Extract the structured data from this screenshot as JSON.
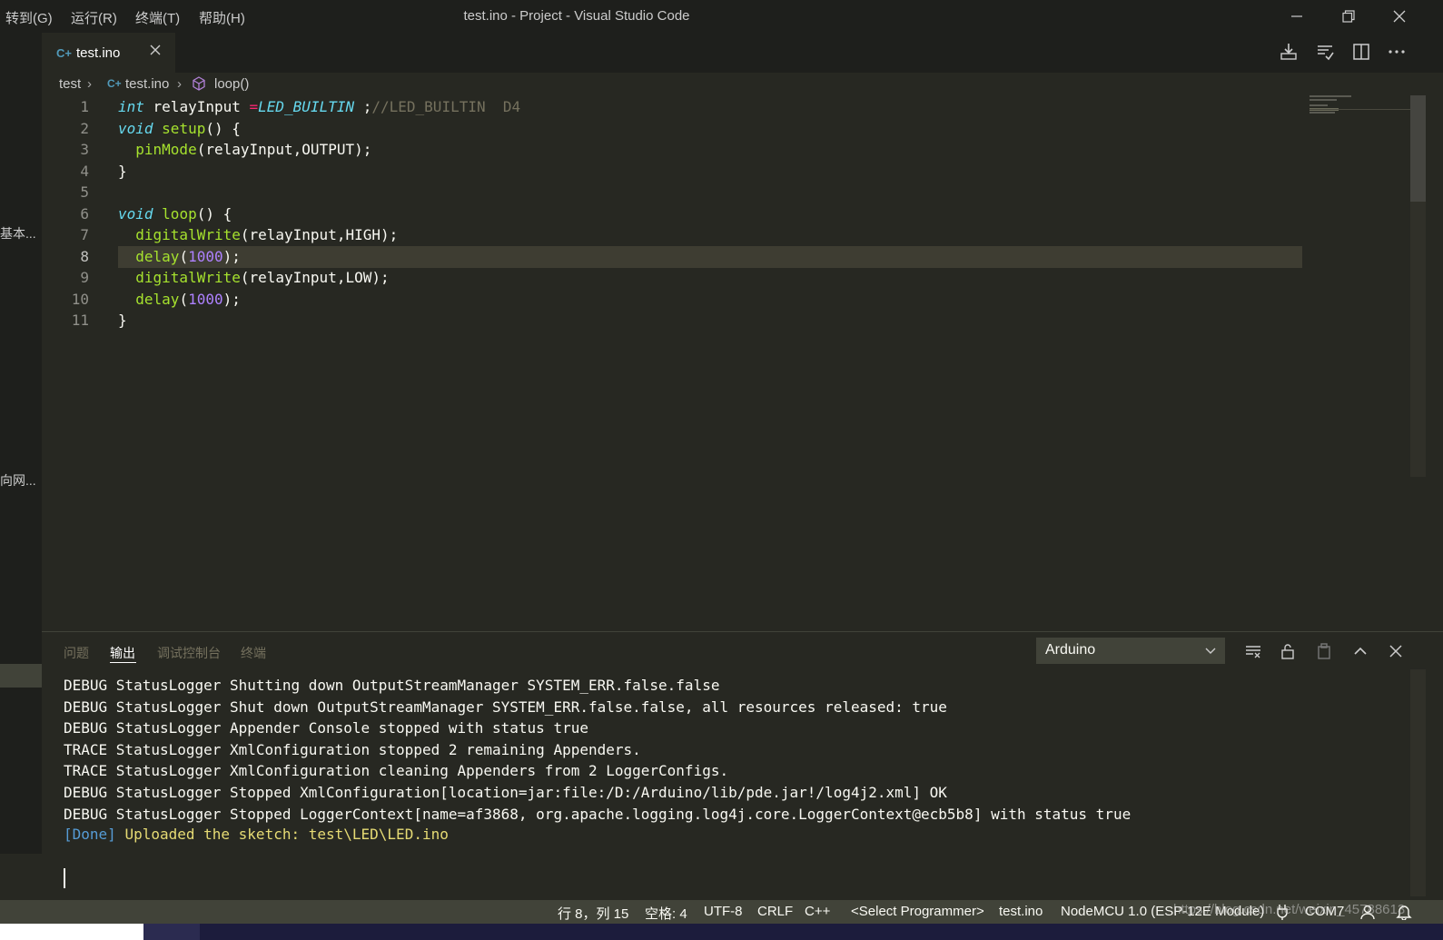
{
  "menu": [
    "转到(G)",
    "运行(R)",
    "终端(T)",
    "帮助(H)"
  ],
  "window_title": "test.ino - Project - Visual Studio Code",
  "tab": {
    "label": "test.ino",
    "icon": "cpp-file-icon"
  },
  "breadcrumb": {
    "folder": "test",
    "file": "test.ino",
    "symbol": "loop()"
  },
  "sidebar_fragments": [
    "基本...",
    "向网..."
  ],
  "editor": {
    "lines": [
      {
        "n": "1",
        "tokens": [
          {
            "c": "kw",
            "t": "int"
          },
          {
            "c": "",
            "t": " relayInput "
          },
          {
            "c": "op",
            "t": "="
          },
          {
            "c": "cst",
            "t": "LED_BUILTIN"
          },
          {
            "c": "",
            "t": " ;"
          },
          {
            "c": "cm",
            "t": "//LED_BUILTIN  D4"
          }
        ]
      },
      {
        "n": "2",
        "tokens": [
          {
            "c": "kw",
            "t": "void"
          },
          {
            "c": "",
            "t": " "
          },
          {
            "c": "fn",
            "t": "setup"
          },
          {
            "c": "",
            "t": "() {"
          }
        ]
      },
      {
        "n": "3",
        "tokens": [
          {
            "c": "",
            "t": "  "
          },
          {
            "c": "fn",
            "t": "pinMode"
          },
          {
            "c": "",
            "t": "(relayInput,OUTPUT);"
          }
        ]
      },
      {
        "n": "4",
        "tokens": [
          {
            "c": "",
            "t": "}"
          }
        ]
      },
      {
        "n": "5",
        "tokens": []
      },
      {
        "n": "6",
        "tokens": [
          {
            "c": "kw",
            "t": "void"
          },
          {
            "c": "",
            "t": " "
          },
          {
            "c": "fn",
            "t": "loop"
          },
          {
            "c": "",
            "t": "() {"
          }
        ]
      },
      {
        "n": "7",
        "tokens": [
          {
            "c": "",
            "t": "  "
          },
          {
            "c": "fn",
            "t": "digitalWrite"
          },
          {
            "c": "",
            "t": "(relayInput,HIGH);"
          }
        ]
      },
      {
        "n": "8",
        "tokens": [
          {
            "c": "",
            "t": "  "
          },
          {
            "c": "fn",
            "t": "delay"
          },
          {
            "c": "",
            "t": "("
          },
          {
            "c": "num",
            "t": "1000"
          },
          {
            "c": "",
            "t": ");"
          }
        ]
      },
      {
        "n": "9",
        "tokens": [
          {
            "c": "",
            "t": "  "
          },
          {
            "c": "fn",
            "t": "digitalWrite"
          },
          {
            "c": "",
            "t": "(relayInput,LOW);"
          }
        ]
      },
      {
        "n": "10",
        "tokens": [
          {
            "c": "",
            "t": "  "
          },
          {
            "c": "fn",
            "t": "delay"
          },
          {
            "c": "",
            "t": "("
          },
          {
            "c": "num",
            "t": "1000"
          },
          {
            "c": "",
            "t": ");"
          }
        ]
      },
      {
        "n": "11",
        "tokens": [
          {
            "c": "",
            "t": "}"
          }
        ]
      }
    ],
    "active_line": 8
  },
  "panel": {
    "tabs": [
      {
        "label": "问题",
        "active": false
      },
      {
        "label": "输出",
        "active": true
      },
      {
        "label": "调试控制台",
        "active": false
      },
      {
        "label": "终端",
        "active": false
      }
    ],
    "output_channel": "Arduino",
    "output_lines": [
      {
        "text": "DEBUG StatusLogger Shutting down OutputStreamManager SYSTEM_ERR.false.false",
        "style": "log"
      },
      {
        "text": "DEBUG StatusLogger Shut down OutputStreamManager SYSTEM_ERR.false.false, all resources released: true",
        "style": "log"
      },
      {
        "text": "DEBUG StatusLogger Appender Console stopped with status true",
        "style": "log"
      },
      {
        "text": "TRACE StatusLogger XmlConfiguration stopped 2 remaining Appenders.",
        "style": "log"
      },
      {
        "text": "TRACE StatusLogger XmlConfiguration cleaning Appenders from 2 LoggerConfigs.",
        "style": "log"
      },
      {
        "text": "DEBUG StatusLogger Stopped XmlConfiguration[location=jar:file:/D:/Arduino/lib/pde.jar!/log4j2.xml] OK",
        "style": "log"
      },
      {
        "text": "DEBUG StatusLogger Stopped LoggerContext[name=af3868, org.apache.logging.log4j.core.LoggerContext@ecb5b8] with status true",
        "style": "log"
      }
    ],
    "done_tag": "[Done]",
    "done_message": "Uploaded the sketch: test\\LED\\LED.ino"
  },
  "statusbar": {
    "position": "行 8，列 15",
    "indent": "空格: 4",
    "encoding": "UTF-8",
    "eol": "CRLF",
    "language": "C++",
    "programmer": "<Select Programmer>",
    "sketch": "test.ino",
    "board": "NodeMCU 1.0 (ESP-12E Module)",
    "port": "COM7",
    "watermark": "https://blog.csdn.net/weixin_45788613"
  },
  "colors": {
    "editor_bg": "#272822",
    "keyword": "#66d9ef",
    "function": "#a6e22e",
    "number": "#ae81ff",
    "comment": "#75715e",
    "operator": "#f92672",
    "done_tag": "#569cd6",
    "done_message": "#e6db74"
  }
}
